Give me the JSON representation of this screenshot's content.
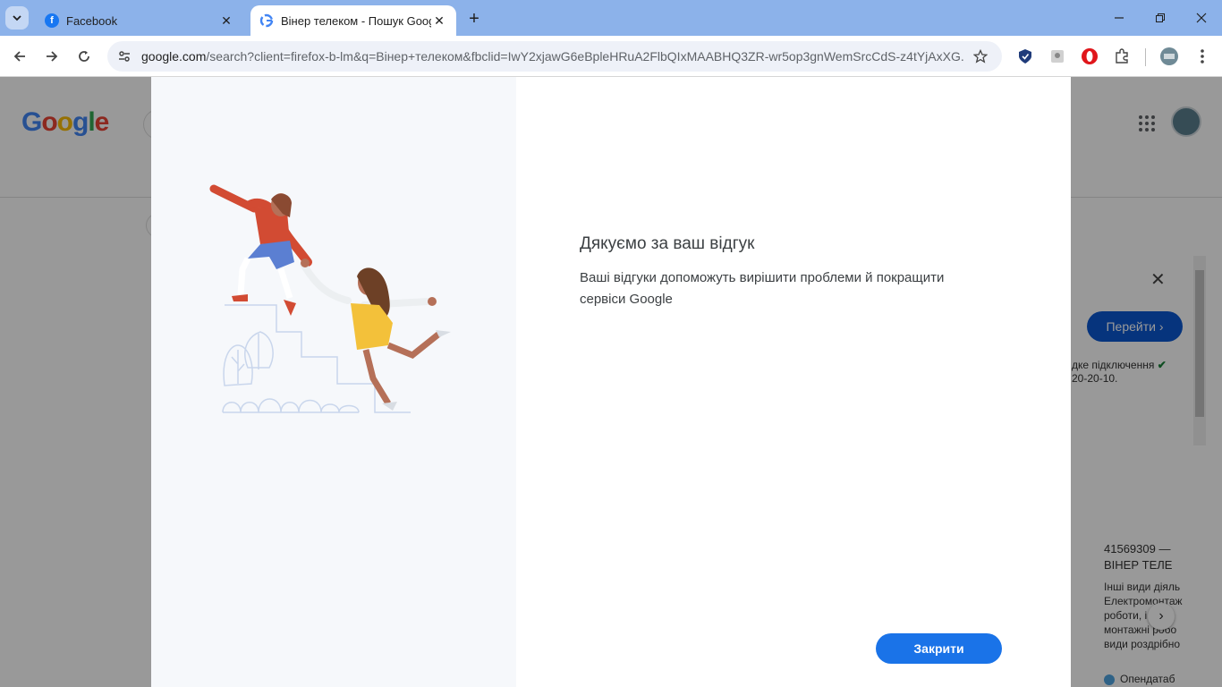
{
  "browser": {
    "tabs": [
      {
        "title": "Facebook",
        "favicon": "facebook-icon",
        "active": false
      },
      {
        "title": "Вінер телеком - Пошук Google",
        "favicon": "google-icon",
        "active": true
      }
    ],
    "url_host": "google.com",
    "url_rest": "/search?client=firefox-b-lm&q=Вінер+телеком&fbclid=IwY2xjawG6eBpleHRuA2FlbQIxMAABHQ3ZR-wr5op3gnWemSrcCdS-z4tYjAxXG...",
    "tabbar_color": "#8cb2ea"
  },
  "page": {
    "logo": "Google",
    "side_panel": {
      "button": "Перейти ›",
      "line1": "дке підключення",
      "line2": "20-20-10."
    },
    "business": {
      "id_line": "41569309 —",
      "name_line": "ВІНЕР ТЕЛЕ",
      "lines": [
        "Інші види діяль",
        "Електромонтаж",
        "роботи, і",
        "монтажні робо",
        "види роздрібно"
      ],
      "source": "Опендатаб"
    }
  },
  "dialog": {
    "title": "Дякуємо за ваш відгук",
    "body": "Ваші відгуки допоможуть вирішити проблеми й покращити сервіси Google",
    "close_button": "Закрити",
    "accent": "#1a73e8"
  }
}
